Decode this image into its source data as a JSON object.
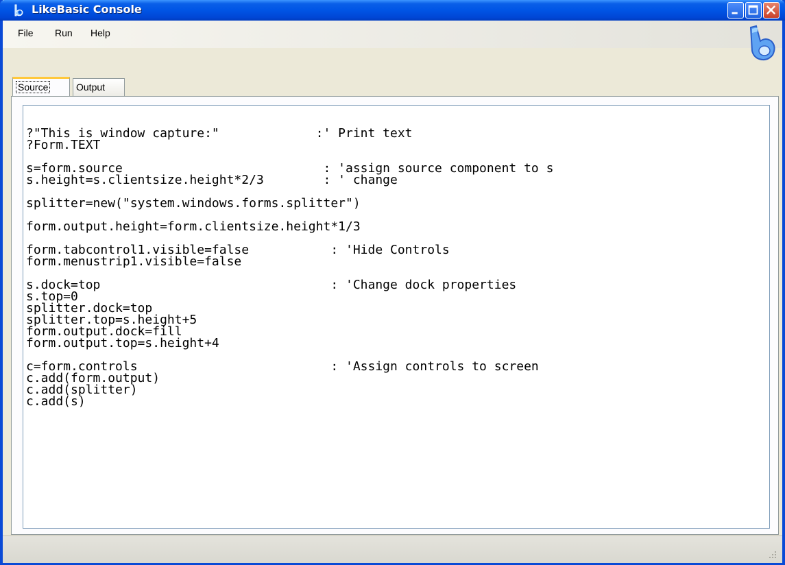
{
  "window": {
    "title": "LikeBasic Console"
  },
  "menu": {
    "items": [
      "File",
      "Run",
      "Help"
    ]
  },
  "tabs": [
    {
      "label": "Source",
      "selected": true
    },
    {
      "label": "Output",
      "selected": false
    }
  ],
  "editor": {
    "lines": [
      "?\"This is window capture:\"             :' Print text",
      "?Form.TEXT",
      "",
      "s=form.source                           : 'assign source component to s",
      "s.height=s.clientsize.height*2/3        : ' change",
      "",
      "splitter=new(\"system.windows.forms.splitter\")",
      "",
      "form.output.height=form.clientsize.height*1/3",
      "",
      "form.tabcontrol1.visible=false           : 'Hide Controls",
      "form.menustrip1.visible=false",
      "",
      "s.dock=top                               : 'Change dock properties",
      "s.top=0",
      "splitter.dock=top",
      "splitter.top=s.height+5",
      "form.output.dock=fill",
      "form.output.top=s.height+4",
      "",
      "c=form.controls                          : 'Assign controls to screen",
      "c.add(form.output)",
      "c.add(splitter)",
      "c.add(s)"
    ]
  },
  "icons": {
    "app": "likebasic-app-icon",
    "brand": "likebasic-logo-icon"
  },
  "colors": {
    "titlebar": "#0055e5",
    "close_button": "#c9412a"
  }
}
